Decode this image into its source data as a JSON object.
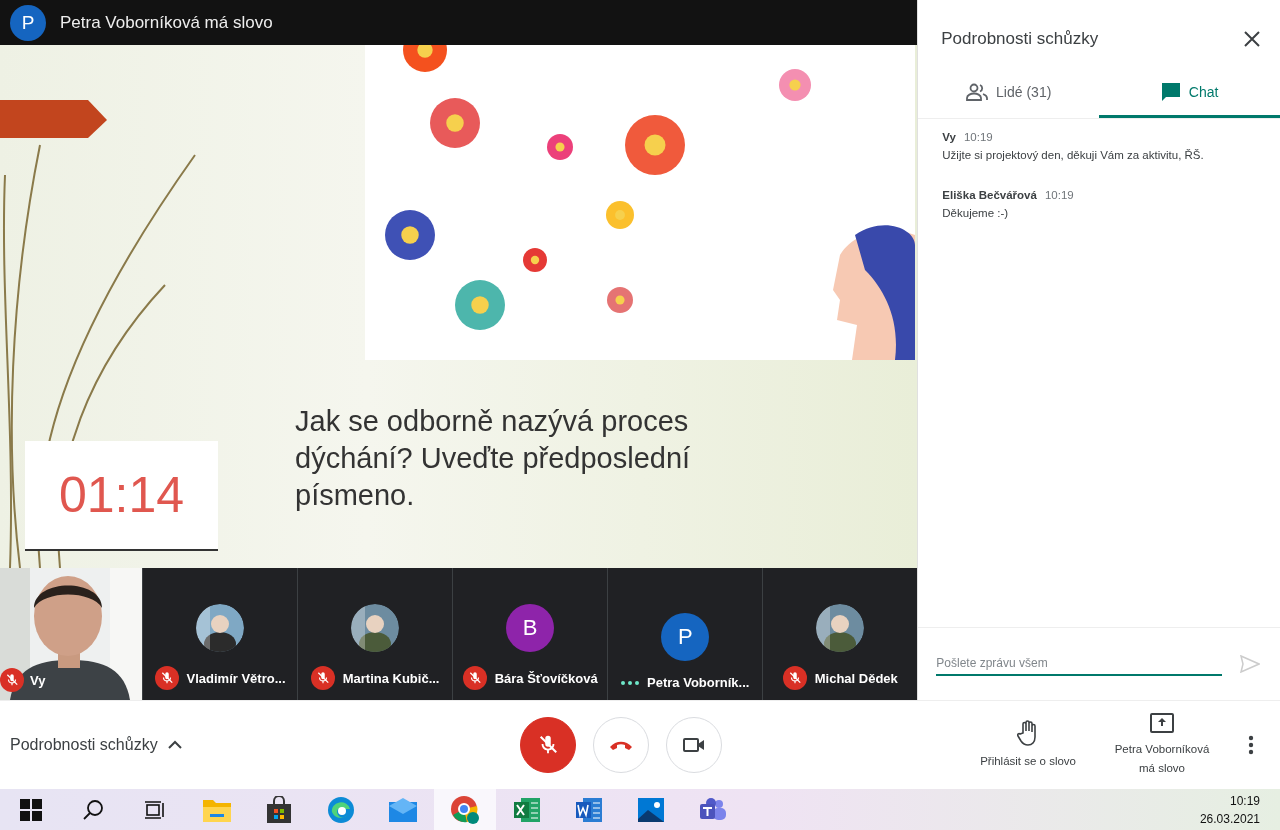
{
  "header": {
    "avatar_letter": "P",
    "title": "Petra Voborníková má slovo"
  },
  "slide": {
    "timer": "01:14",
    "question": "Jak se odborně nazývá proces dýchání? Uveďte předposlední písmeno."
  },
  "participants": [
    {
      "name": "Vy",
      "kind": "video",
      "muted": true
    },
    {
      "name": "Vladimír Větro...",
      "muted": true
    },
    {
      "name": "Martina Kubič...",
      "muted": true
    },
    {
      "name": "Bára Šťovíčková",
      "kind": "letter",
      "letter": "B",
      "color": "#8e24aa",
      "muted": true
    },
    {
      "name": "Petra Voborník...",
      "kind": "letter",
      "letter": "P",
      "color": "#1565c0",
      "muted": false
    },
    {
      "name": "Michal Dědek",
      "muted": true
    }
  ],
  "panel": {
    "title": "Podrobnosti schůzky",
    "tabs": [
      {
        "label": "Lidé (31)",
        "kind": "people",
        "selected": false
      },
      {
        "label": "Chat",
        "kind": "chat",
        "selected": true
      }
    ],
    "messages": [
      {
        "sender": "Vy",
        "time": "10:19",
        "text": "Užijte si projektový den, děkuji Vám za aktivitu, ŘŠ."
      },
      {
        "sender": "Eliška Bečvářová",
        "time": "10:19",
        "text": "Děkujeme :-)"
      }
    ],
    "input": {
      "placeholder": "Pošlete zprávu všem"
    }
  },
  "controls": {
    "details": "Podrobnosti schůzky",
    "buttons": [
      {
        "kind": "mic"
      },
      {
        "kind": "hangup"
      },
      {
        "kind": "camera"
      }
    ],
    "actions": [
      {
        "kind": "hand",
        "label": "Přihlásit se o slovo"
      },
      {
        "kind": "present",
        "label": "Petra Voborníková má slovo"
      }
    ]
  },
  "taskbar": {
    "apps": [
      {
        "kind": "start",
        "selected": false
      },
      {
        "kind": "search",
        "selected": false
      },
      {
        "kind": "taskview",
        "selected": false
      },
      {
        "kind": "folder",
        "selected": false
      },
      {
        "kind": "store",
        "selected": false
      },
      {
        "kind": "edge",
        "selected": false
      },
      {
        "kind": "mail",
        "selected": false
      },
      {
        "kind": "chrome",
        "selected": true
      },
      {
        "kind": "excel",
        "selected": false
      },
      {
        "kind": "word",
        "selected": false
      },
      {
        "kind": "photos",
        "selected": false
      },
      {
        "kind": "teams",
        "selected": false
      }
    ],
    "time": "10:19",
    "date": "26.03.2021"
  }
}
